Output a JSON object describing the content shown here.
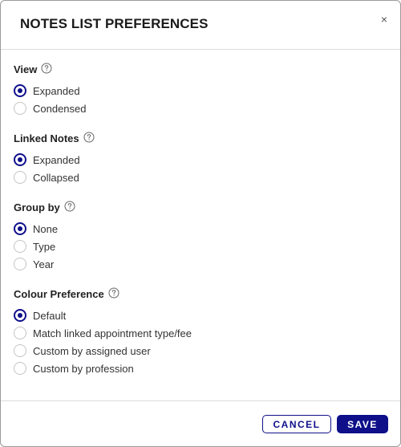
{
  "dialog": {
    "title": "NOTES LIST PREFERENCES",
    "close_label": "×"
  },
  "sections": [
    {
      "title": "View",
      "options": [
        {
          "label": "Expanded",
          "checked": true
        },
        {
          "label": "Condensed",
          "checked": false
        }
      ]
    },
    {
      "title": "Linked Notes",
      "options": [
        {
          "label": "Expanded",
          "checked": true
        },
        {
          "label": "Collapsed",
          "checked": false
        }
      ]
    },
    {
      "title": "Group by",
      "options": [
        {
          "label": "None",
          "checked": true
        },
        {
          "label": "Type",
          "checked": false
        },
        {
          "label": "Year",
          "checked": false
        }
      ]
    },
    {
      "title": "Colour Preference",
      "options": [
        {
          "label": "Default",
          "checked": true
        },
        {
          "label": "Match linked appointment type/fee",
          "checked": false
        },
        {
          "label": "Custom by assigned user",
          "checked": false
        },
        {
          "label": "Custom by profession",
          "checked": false
        }
      ]
    }
  ],
  "footer": {
    "cancel_label": "CANCEL",
    "save_label": "SAVE"
  },
  "colors": {
    "accent": "#0f0f8a",
    "border": "#9a9a9a",
    "divider": "#dcdcdc"
  },
  "icons": {
    "help": "help-circle-icon",
    "close": "close-icon"
  }
}
